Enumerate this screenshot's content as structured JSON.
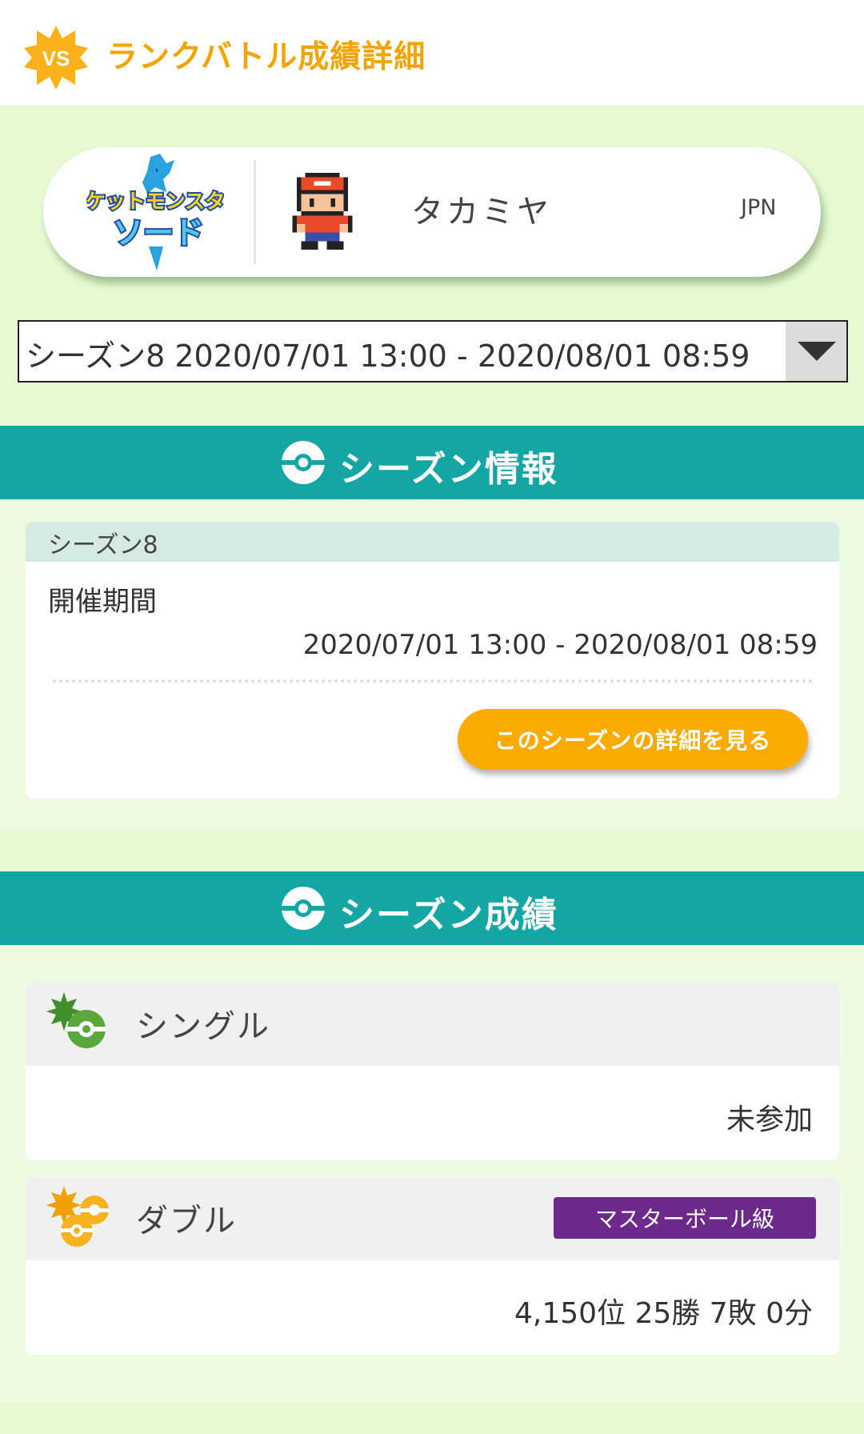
{
  "header": {
    "badge_text": "VS",
    "title": "ランクバトル成績詳細"
  },
  "profile": {
    "game_logo_line1": "ポケットモンスター",
    "game_logo_line2": "ソード",
    "trainer_name": "タカミヤ",
    "country": "JPN"
  },
  "season_select": {
    "selected": "シーズン8 2020/07/01 13:00 - 2020/08/01 08:59"
  },
  "season_info": {
    "section_title": "シーズン情報",
    "season_label": "シーズン8",
    "period_label": "開催期間",
    "period_value": "2020/07/01 13:00 - 2020/08/01 08:59",
    "detail_button": "このシーズンの詳細を見る"
  },
  "season_results": {
    "section_title": "シーズン成績",
    "single": {
      "label": "シングル",
      "value": "未参加"
    },
    "double": {
      "label": "ダブル",
      "rank_badge": "マスターボール級",
      "value": "4,150位 25勝 7敗 0分"
    }
  },
  "colors": {
    "brand_orange": "#f5a300",
    "teal": "#14a6a4",
    "master_ball_purple": "#6b2a8c",
    "background_green": "#e6fbd4"
  }
}
